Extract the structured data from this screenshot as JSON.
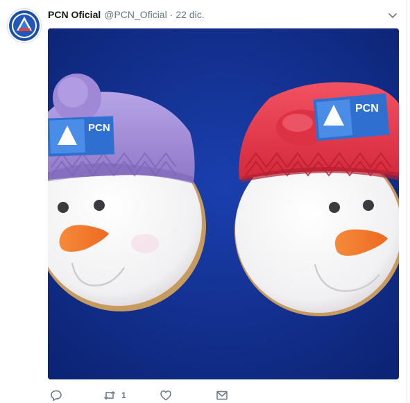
{
  "tweet": {
    "display_name": "PCN Oficial",
    "handle": "@PCN_Oficial",
    "separator": "·",
    "date": "22 dic."
  },
  "media": {
    "left_cookie_label": "PCN",
    "right_cookie_label": "PCN"
  },
  "actions": {
    "reply_count": "",
    "retweet_count": "1",
    "like_count": ""
  },
  "icons": {
    "avatar": "pcn-logo",
    "caret": "chevron-down-icon",
    "reply": "reply-icon",
    "retweet": "retweet-icon",
    "like": "heart-icon",
    "dm": "envelope-icon"
  },
  "colors": {
    "name": "#14171a",
    "muted": "#657786",
    "background": "#12318f",
    "purple_hat": "#a48fd8",
    "red_hat": "#e8394a",
    "carrot": "#f2762e"
  }
}
